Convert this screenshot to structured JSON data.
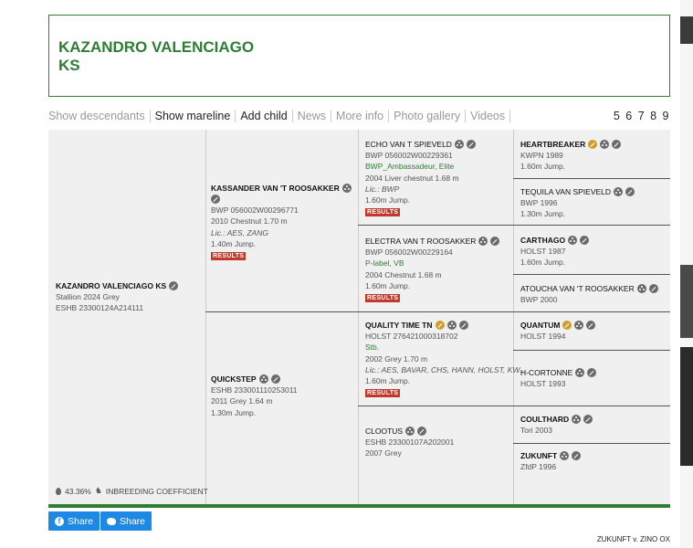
{
  "title": {
    "line1": "KAZANDRO VALENCIAGO",
    "line2": "KS"
  },
  "nav": {
    "items": [
      {
        "label": "Show descendants",
        "enabled": false
      },
      {
        "label": "Show mareline",
        "enabled": true
      },
      {
        "label": "Add child",
        "enabled": true
      },
      {
        "label": "News",
        "enabled": false
      },
      {
        "label": "More info",
        "enabled": false
      },
      {
        "label": "Photo gallery",
        "enabled": false
      },
      {
        "label": "Videos",
        "enabled": false
      }
    ],
    "pages": "5 6 7 8 9"
  },
  "pedigree": {
    "subject": {
      "name": "KAZANDRO VALENCIAGO KS",
      "line1": "Stallion 2024 Grey",
      "line2": "ESHB 23300124A214111"
    },
    "sire": {
      "name": "KASSANDER VAN 'T ROOSAKKER",
      "reg": "BWP 056002W00296771",
      "info": "2010 Chestnut 1.70 m",
      "lic": "Lic.: AES, ZANG",
      "jump": "1.40m Jump.",
      "results": "RESULTS"
    },
    "dam": {
      "name": "QUICKSTEP",
      "reg": "ESHB 233001110253011",
      "info": "2011 Grey 1.64 m",
      "jump": "1.30m Jump."
    },
    "gp": [
      {
        "name": "ECHO VAN T SPIEVELD",
        "reg": "BWP 056002W00229361",
        "predicate": "BWP_Ambassadeur, Elite",
        "info": "2004 Liver chestnut 1.68 m",
        "lic": "Lic.: BWP",
        "jump": "1.60m Jump.",
        "results": "RESULTS"
      },
      {
        "name": "ELECTRA VAN T ROOSAKKER",
        "reg": "BWP 056002W00229164",
        "predicate": "P-label, VB",
        "info": "2004 Chestnut 1.68 m",
        "jump": "1.60m Jump.",
        "results": "RESULTS"
      },
      {
        "name": "QUALITY TIME TN",
        "reg": "HOLST 276421000318702",
        "predicate": "Stb.",
        "info": "2002 Grey 1.70 m",
        "lic": "Lic.: AES, BAVAR, CHS, HANN, HOLST, KW...",
        "jump": "1.60m Jump.",
        "results": "RESULTS"
      },
      {
        "name": "CLOOTUS",
        "reg": "ESHB 23300107A202001",
        "info": "2007 Grey"
      }
    ],
    "ggp": [
      {
        "name": "HEARTBREAKER",
        "reg": "KWPN 1989",
        "jump": "1.60m Jump."
      },
      {
        "name": "TEQUILA VAN SPIEVELD",
        "reg": "BWP 1996",
        "jump": "1.30m Jump."
      },
      {
        "name": "CARTHAGO",
        "reg": "HOLST 1987",
        "jump": "1.60m Jump."
      },
      {
        "name": "ATOUCHA VAN 'T ROOSAKKER",
        "reg": "BWP 2000"
      },
      {
        "name": "QUANTUM",
        "reg": "HOLST 1994"
      },
      {
        "name": "H-CORTONNE",
        "reg": "HOLST 1993"
      },
      {
        "name": "COULTHARD",
        "reg": "Tori 2003"
      },
      {
        "name": "ZUKUNFT",
        "reg": "ZfdP 1996"
      }
    ],
    "inbreeding": {
      "value": "43.36%",
      "label": "INBREEDING COEFFICIENT"
    }
  },
  "share": {
    "facebook": "Share",
    "twitter": "Share"
  },
  "footer": "ZUKUNFT v. ZINO OX"
}
